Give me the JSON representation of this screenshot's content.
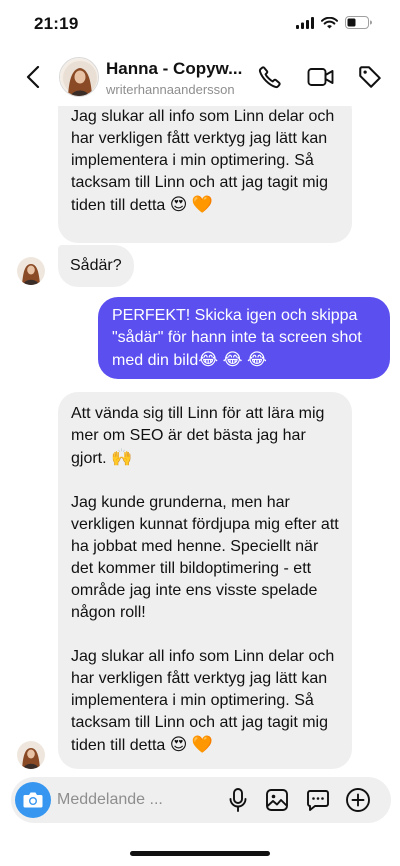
{
  "status_bar": {
    "time": "21:19",
    "icons": [
      "signal-icon",
      "wifi-icon",
      "battery-icon"
    ]
  },
  "header": {
    "name": "Hanna - Copyw...",
    "username": "writerhannaandersson",
    "icons": [
      "back-icon",
      "phone-icon",
      "video-icon",
      "tag-icon"
    ]
  },
  "messages": [
    {
      "direction": "incoming",
      "paragraphs": [
        "Jag slukar all info som Linn delar och har verkligen fått verktyg jag lätt kan implementera i min optimering. Så tacksam till Linn och att jag tagit mig tiden till detta"
      ],
      "emojis": [
        "😍",
        "🧡"
      ]
    },
    {
      "direction": "incoming",
      "paragraphs": [
        "Sådär?"
      ]
    },
    {
      "direction": "outgoing",
      "paragraphs": [
        "PERFEKT! Skicka igen och skippa \"sådär\" för hann inte ta screen shot med din bild"
      ],
      "emojis": [
        "😂",
        "😂",
        "😂"
      ]
    },
    {
      "direction": "incoming",
      "paragraphs": [
        "Att vända sig till Linn för att lära mig mer om SEO är det bästa jag har gjort.",
        "Jag kunde grunderna, men har verkligen kunnat fördjupa mig efter att ha jobbat med henne. Speciellt när det kommer till bildoptimering - ett område jag inte ens visste spelade någon roll!",
        "Jag slukar all info som Linn delar och har verkligen fått verktyg jag lätt kan implementera i min optimering. Så tacksam till Linn och att jag tagit mig tiden till detta"
      ],
      "emojis": [
        "🙌",
        "😍",
        "🧡"
      ]
    }
  ],
  "composer": {
    "placeholder": "Meddelande ...",
    "value": "",
    "icons": [
      "camera-icon",
      "microphone-icon",
      "gallery-icon",
      "sticker-icon",
      "add-icon"
    ]
  },
  "colors": {
    "outgoing_bubble": "#5b4ff0",
    "incoming_bubble": "#efefef",
    "camera_button": "#3797f0",
    "secondary_text": "#8e8e8e"
  }
}
